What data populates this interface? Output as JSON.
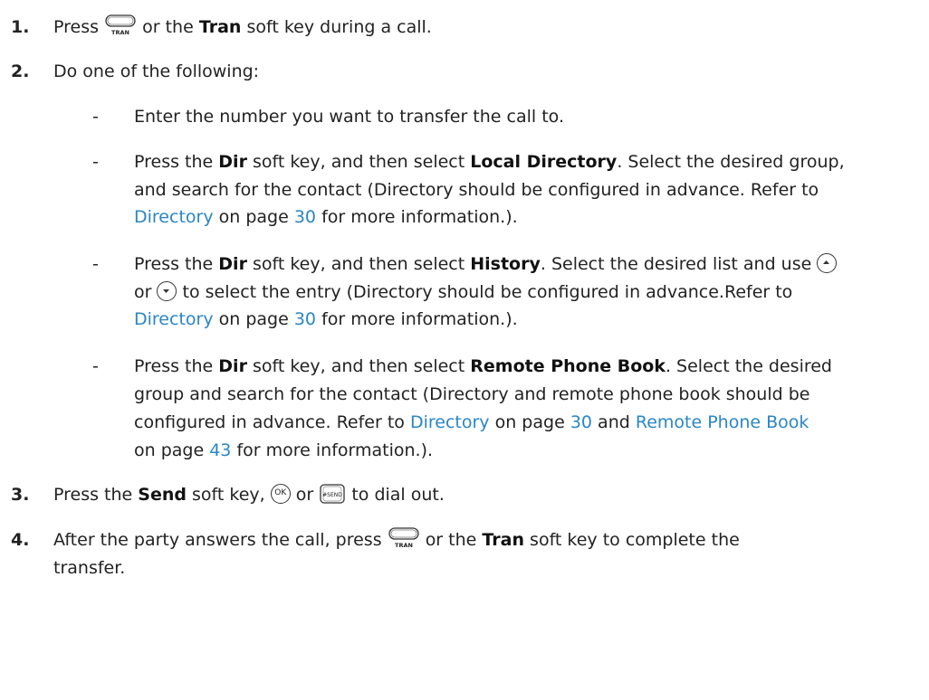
{
  "steps": {
    "s1": {
      "num": "1.",
      "a": "Press",
      "b": "or the",
      "key": "Tran",
      "c": "soft key during a call."
    },
    "s2": {
      "num": "2.",
      "a": "Do one of the following:"
    },
    "s2o1": {
      "a": "Enter the number you want to transfer the call to."
    },
    "s2o2": {
      "l1a": "Press the",
      "l1key": "Dir",
      "l1b": "soft key, and then select",
      "l1sel": "Local Directory",
      "l1c": ". Select the desired group,",
      "l2": "and search for the contact (Directory should be configured in advance. Refer to",
      "l3link": "Directory",
      "l3a": "on page",
      "l3page": "30",
      "l3b": "for more information.)."
    },
    "s2o3": {
      "l1a": "Press the",
      "l1key": "Dir",
      "l1b": "soft key, and then select",
      "l1sel": "History",
      "l1c": ". Select the desired list and use",
      "l2a": "or",
      "l2b": "to select the entry (Directory should be configured in advance.Refer to",
      "l3link": "Directory",
      "l3a": "on page",
      "l3page": "30",
      "l3b": "for more information.)."
    },
    "s2o4": {
      "l1a": "Press the",
      "l1key": "Dir",
      "l1b": "soft key, and then select",
      "l1sel": "Remote Phone Book",
      "l1c": ". Select the desired",
      "l2": "group and search for the contact (Directory and remote phone book should be",
      "l3a": "configured in advance. Refer to",
      "l3link1": "Directory",
      "l3b": "on page",
      "l3page1": "30",
      "l3c": "and",
      "l3link2": "Remote Phone Book",
      "l4a": "on page",
      "l4page": "43",
      "l4b": "for more information.)."
    },
    "s3": {
      "num": "3.",
      "a": "Press the",
      "key": "Send",
      "b": "soft key,",
      "c": "or",
      "d": "to dial out."
    },
    "s4": {
      "num": "4.",
      "l1a": "After the party answers the call, press",
      "l1b": "or the",
      "key": "Tran",
      "l1c": "soft key to complete the",
      "l2": "transfer."
    }
  },
  "icons": {
    "tran_label": "TRAN",
    "ok_label": "OK",
    "send_label": "#SEND",
    "dash": "-"
  }
}
